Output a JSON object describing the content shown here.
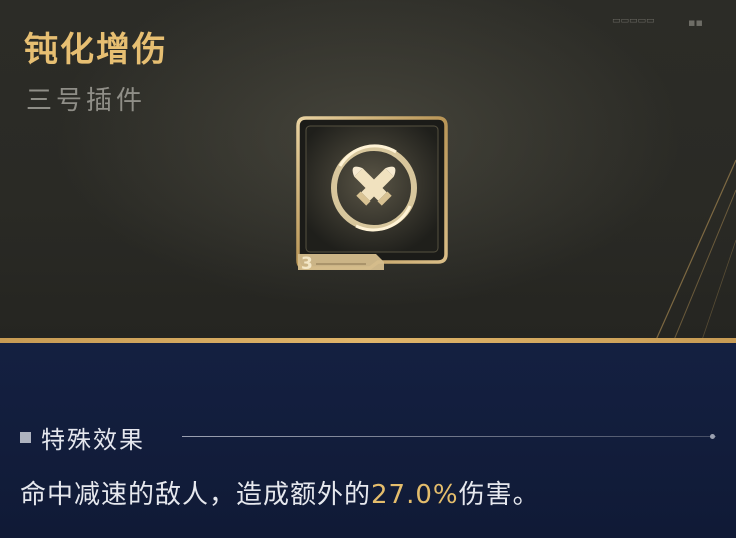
{
  "item": {
    "name": "钝化增伤",
    "slot_type": "三号插件",
    "slot_number": "3",
    "icon": "crossed-bullets-icon"
  },
  "effect": {
    "header": "特殊效果",
    "text_before": "命中减速的敌人，造成额外的",
    "value": "27.0%",
    "text_after": "伤害。"
  },
  "colors": {
    "title_gold": "#e7bf72",
    "highlight": "#e4bd6c",
    "top_bg": "#2b2b26",
    "bottom_bg": "#142041",
    "accent_line": "#d7ab5f"
  }
}
